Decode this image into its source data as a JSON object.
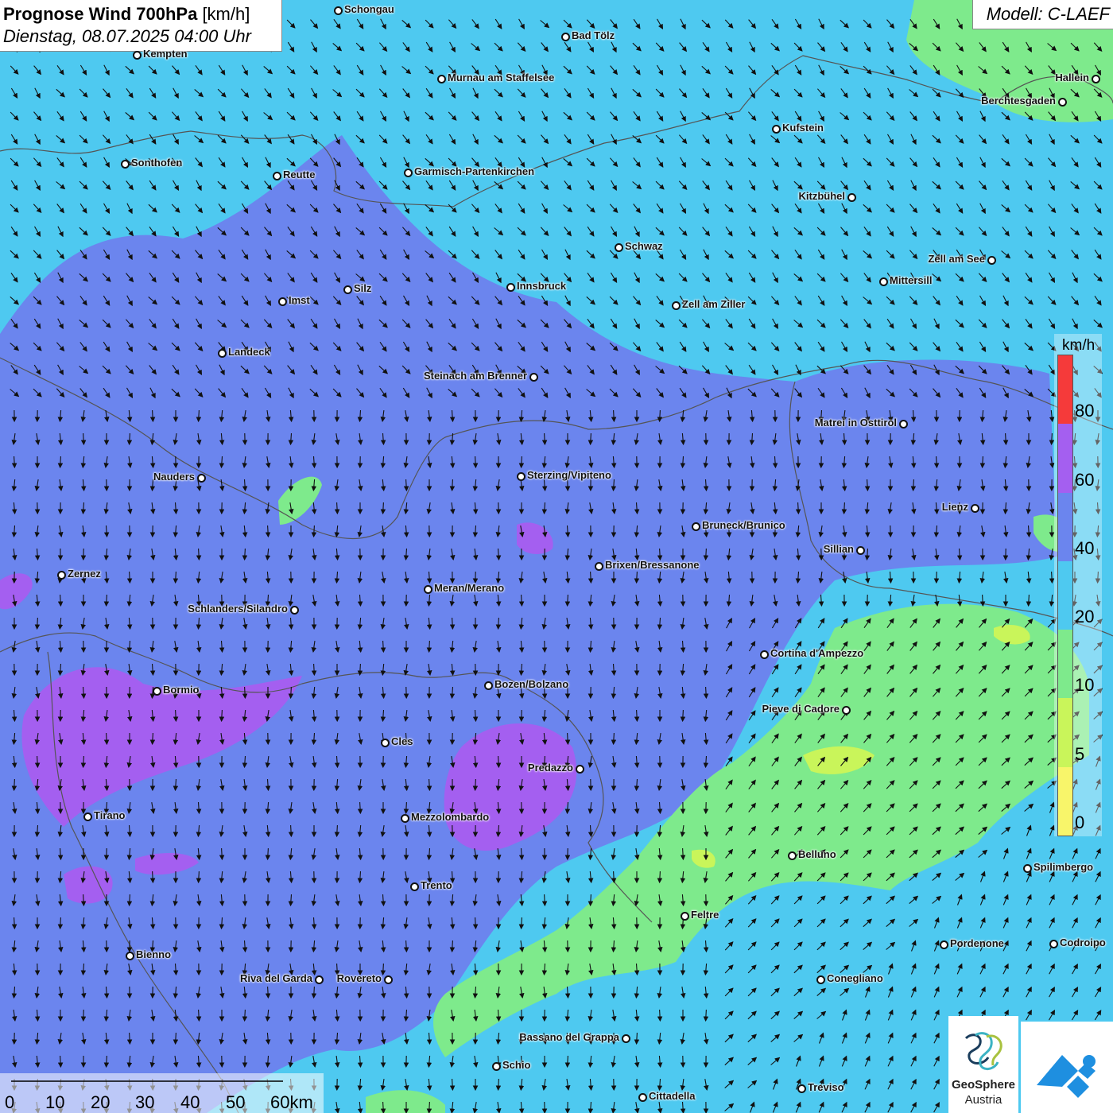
{
  "header": {
    "title_bold": "Prognose Wind 700hPa",
    "title_unit": "[km/h]",
    "datetime": "Dienstag, 08.07.2025 04:00 Uhr",
    "model": "Modell: C-LAEF"
  },
  "legend": {
    "unit": "km/h",
    "labels": [
      "80",
      "60",
      "40",
      "20",
      "10",
      "5",
      "0"
    ],
    "colors": [
      "#f53a3a",
      "#a45ff0",
      "#6b85ee",
      "#4ec9f0",
      "#7eea8c",
      "#c9f55a",
      "#f8f56a"
    ]
  },
  "scale": {
    "labels": [
      "0",
      "10",
      "20",
      "30",
      "40",
      "50",
      "60km"
    ]
  },
  "logos": {
    "geosphere_line1": "GeoSphere",
    "geosphere_line2": "Austria"
  },
  "cities": [
    {
      "name": "Schongau"
    },
    {
      "name": "Bad Tölz"
    },
    {
      "name": "Kempten"
    },
    {
      "name": "Murnau am Staffelsee"
    },
    {
      "name": "Hallein"
    },
    {
      "name": "Berchtesgaden"
    },
    {
      "name": "Kufstein"
    },
    {
      "name": "Sonthofen"
    },
    {
      "name": "Reutte"
    },
    {
      "name": "Garmisch-Partenkirchen"
    },
    {
      "name": "Kitzbühel"
    },
    {
      "name": "Schwaz"
    },
    {
      "name": "Zell am See"
    },
    {
      "name": "Mittersill"
    },
    {
      "name": "Innsbruck"
    },
    {
      "name": "Silz"
    },
    {
      "name": "Imst"
    },
    {
      "name": "Zell am Ziller"
    },
    {
      "name": "Landeck"
    },
    {
      "name": "Steinach am Brenner"
    },
    {
      "name": "Matrei in Osttirol"
    },
    {
      "name": "Nauders"
    },
    {
      "name": "Sterzing/Vipiteno"
    },
    {
      "name": "Lienz"
    },
    {
      "name": "Bruneck/Brunico"
    },
    {
      "name": "Sillian"
    },
    {
      "name": "Brixen/Bressanone"
    },
    {
      "name": "Zernez"
    },
    {
      "name": "Meran/Merano"
    },
    {
      "name": "Schlanders/Silandro"
    },
    {
      "name": "Cortina d'Ampezzo"
    },
    {
      "name": "Bozen/Bolzano"
    },
    {
      "name": "Bormio"
    },
    {
      "name": "Pieve di Cadore"
    },
    {
      "name": "Cles"
    },
    {
      "name": "Predazzo"
    },
    {
      "name": "Tirano"
    },
    {
      "name": "Mezzolombardo"
    },
    {
      "name": "Belluno"
    },
    {
      "name": "Spilimbergo"
    },
    {
      "name": "Trento"
    },
    {
      "name": "Feltre"
    },
    {
      "name": "Pordenone"
    },
    {
      "name": "Codroipo"
    },
    {
      "name": "Bienno"
    },
    {
      "name": "Riva del Garda"
    },
    {
      "name": "Rovereto"
    },
    {
      "name": "Conegliano"
    },
    {
      "name": "Bassano del Grappa"
    },
    {
      "name": "Schio"
    },
    {
      "name": "Treviso"
    },
    {
      "name": "Cittadella"
    }
  ]
}
